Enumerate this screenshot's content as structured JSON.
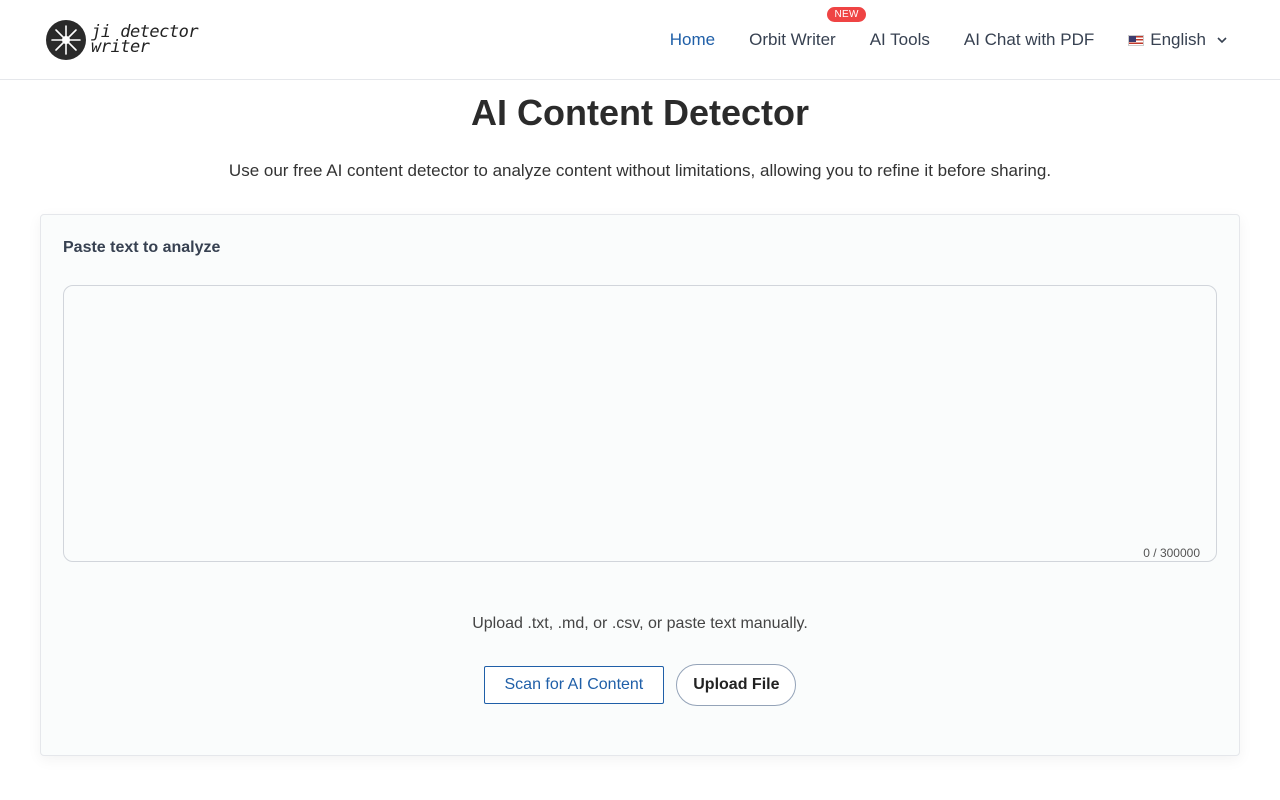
{
  "header": {
    "logo": {
      "line1": "ji detector",
      "line2": "writer"
    },
    "nav": [
      {
        "label": "Home",
        "active": true
      },
      {
        "label": "Orbit Writer",
        "badge": "NEW"
      },
      {
        "label": "AI Tools"
      },
      {
        "label": "AI Chat with PDF"
      }
    ],
    "language": {
      "label": "English",
      "flag": "us-flag"
    }
  },
  "main": {
    "title": "AI Content Detector",
    "subtitle": "Use our free AI content detector to analyze content without limitations, allowing you to refine it before sharing.",
    "card": {
      "label": "Paste text to analyze",
      "textarea_value": "",
      "counter": "0 / 300000",
      "hint": "Upload .txt, .md, or .csv, or paste text manually.",
      "scan_button": "Scan for AI Content",
      "upload_button": "Upload File"
    }
  },
  "colors": {
    "accent": "#1f5fa8",
    "badge": "#ef4444",
    "text": "#374151"
  }
}
